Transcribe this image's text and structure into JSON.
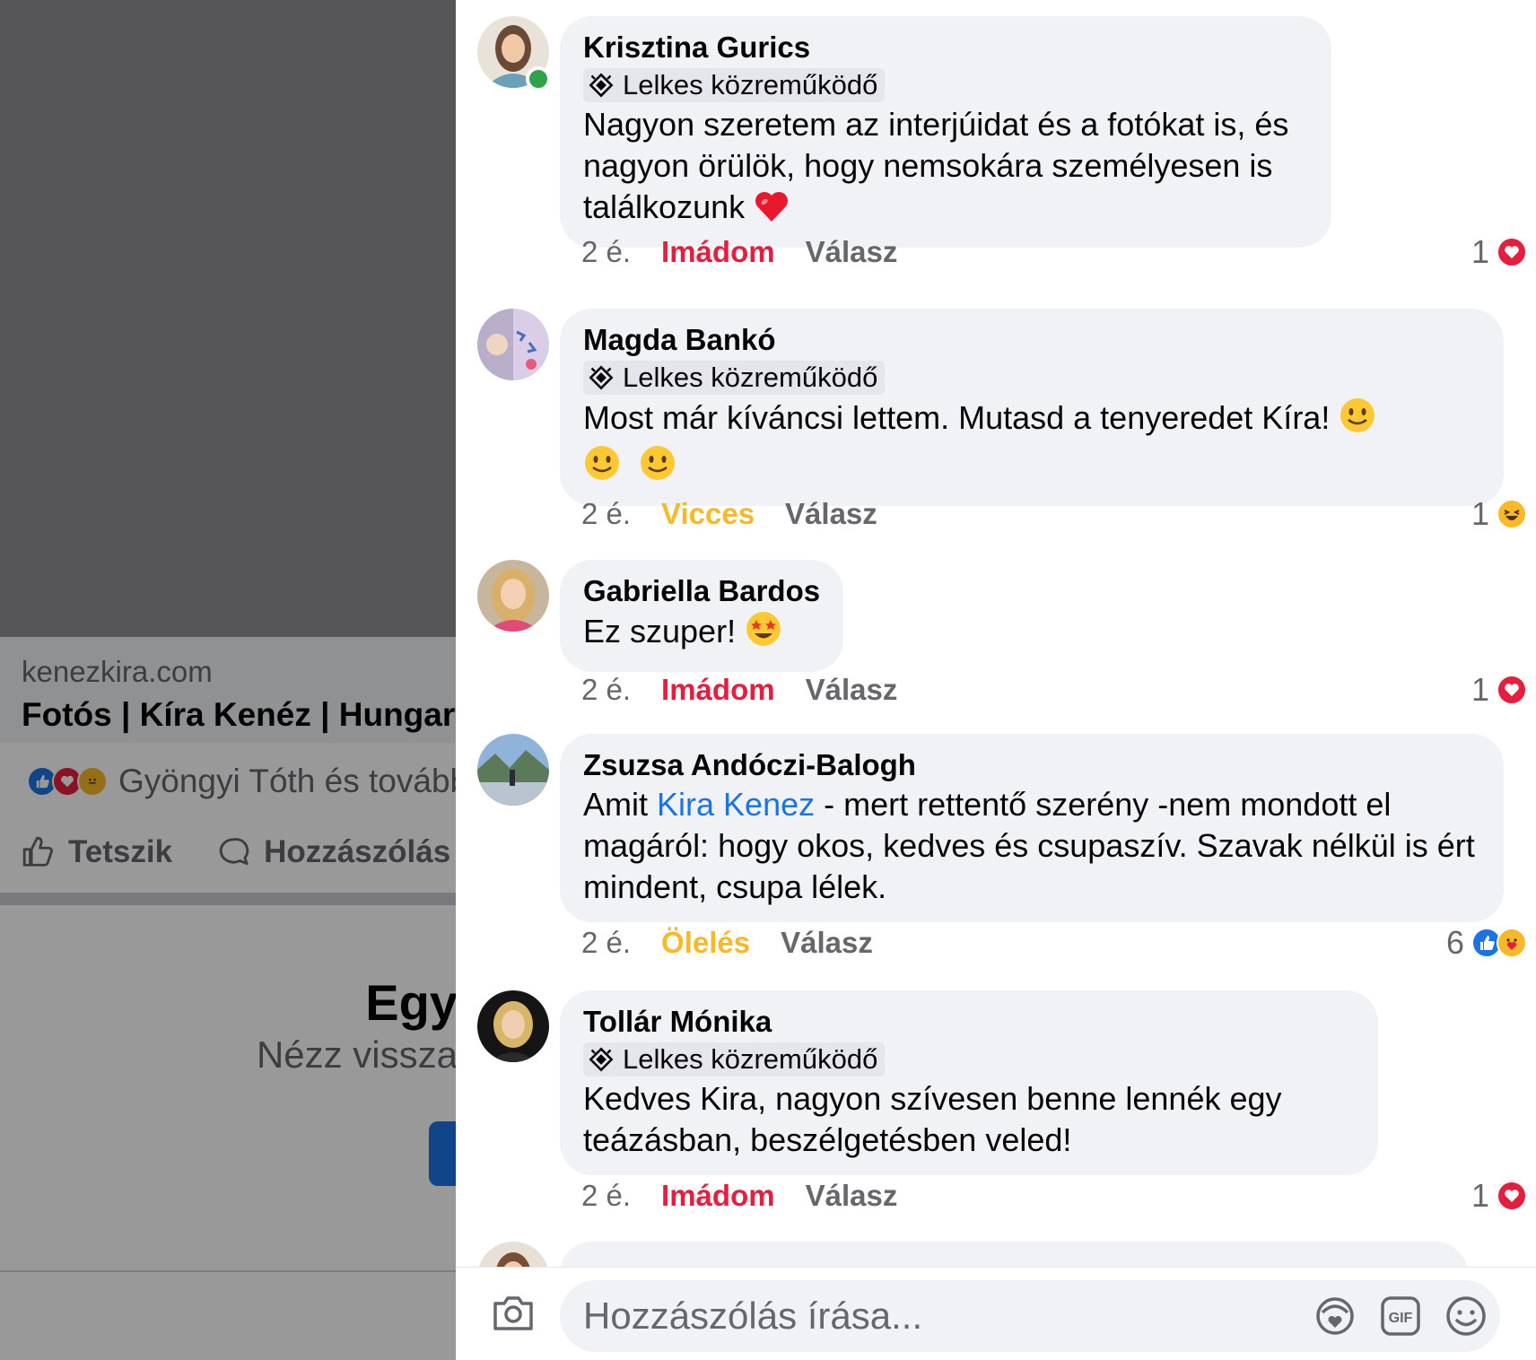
{
  "background_post": {
    "link_domain": "kenezkira.com",
    "link_title": "Fotós | Kíra Kenéz | Hungary",
    "reactions_text": "Gyöngyi Tóth és további",
    "like_label": "Tetszik",
    "comment_label": "Hozzászólás",
    "headline": "Egy",
    "subline": "Nézz vissza"
  },
  "comments": [
    {
      "author": "Krisztina Gurics",
      "badge": "Lelkes közreműködő",
      "text": "Nagyon szeretem az interjúidat és a fotókat is, és nagyon örülök, hogy nemsokára személyesen is találkozunk",
      "time": "2 é.",
      "reaction_label": "Imádom",
      "reply_label": "Válasz",
      "reaction_count": "1"
    },
    {
      "author": "Magda Bankó",
      "badge": "Lelkes közreműködő",
      "text": "Most már kíváncsi lettem. Mutasd a tenyeredet Kíra!",
      "time": "2 é.",
      "reaction_label": "Vicces",
      "reply_label": "Válasz",
      "reaction_count": "1"
    },
    {
      "author": "Gabriella Bardos",
      "text": "Ez szuper!",
      "time": "2 é.",
      "reaction_label": "Imádom",
      "reply_label": "Válasz",
      "reaction_count": "1"
    },
    {
      "author": "Zsuzsa Andóczi-Balogh",
      "text_before": "Amit ",
      "mention": "Kira Kenez",
      "text_after": " - mert rettentő szerény -nem mondott el magáról: hogy okos, kedves és csupaszív. Szavak nélkül is ért mindent, csupa lélek.",
      "time": "2 é.",
      "reaction_label": "Ölelés",
      "reply_label": "Válasz",
      "reaction_count": "6"
    },
    {
      "author": "Tollár Mónika",
      "badge": "Lelkes közreműködő",
      "text": "Kedves Kira, nagyon szívesen benne lennék egy teázásban, beszélgetésben veled!",
      "time": "2 é.",
      "reaction_label": "Imádom",
      "reply_label": "Válasz",
      "reaction_count": "1"
    }
  ],
  "composer": {
    "placeholder": "Hozzászólás írása..."
  },
  "icons": {
    "camera": "camera-icon",
    "avatar_sticker": "avatar-sticker-icon",
    "gif": "gif-icon",
    "emoji": "emoji-icon",
    "badge": "badge-diamond-icon"
  },
  "colors": {
    "love": "#e41e3f",
    "haha": "#f7b928",
    "link": "#1b74e4",
    "bubble": "#f0f2f5",
    "secondary_text": "#65676b",
    "online": "#31a24c"
  }
}
